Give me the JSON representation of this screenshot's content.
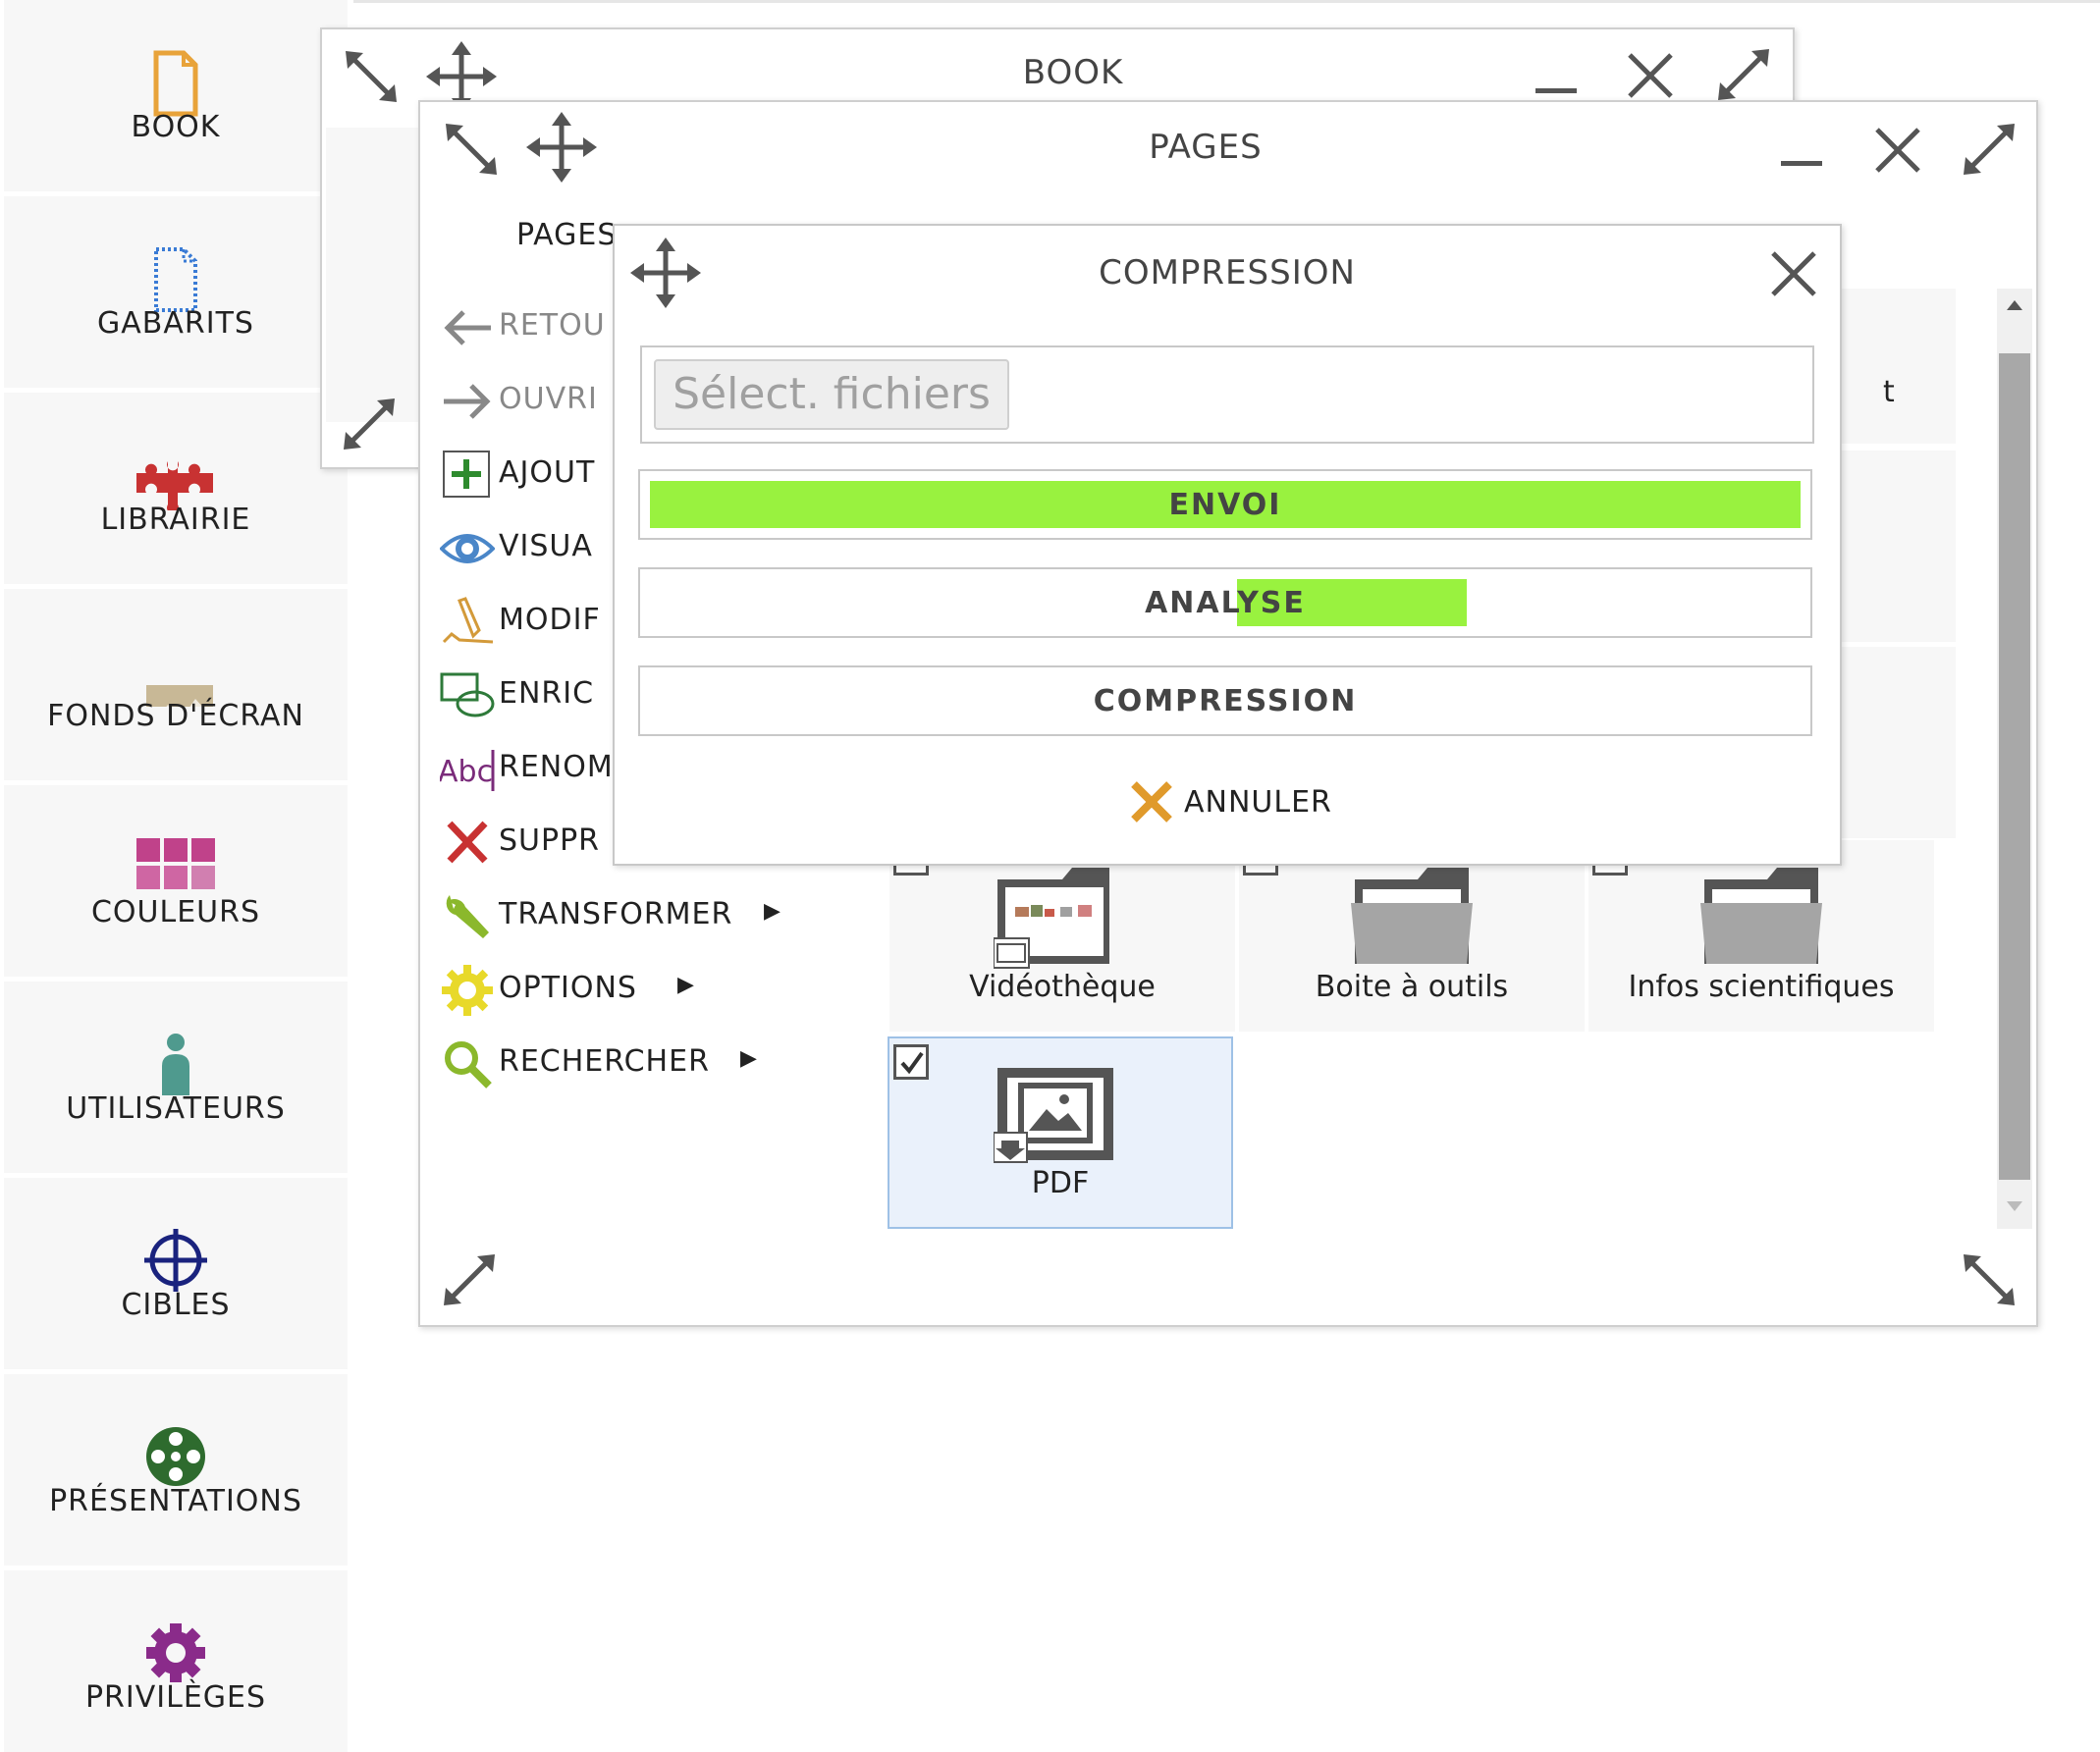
{
  "sidebar": {
    "items": [
      {
        "label": "BOOK",
        "icon": "book-icon",
        "color": "#e8a33a"
      },
      {
        "label": "GABARITS",
        "icon": "template-icon",
        "color": "#3a7bd5"
      },
      {
        "label": "LIBRAIRIE",
        "icon": "puzzle-icon",
        "color": "#c83232"
      },
      {
        "label": "FONDS D'ÉCRAN",
        "icon": "landscape-icon",
        "color": "#c8b896"
      },
      {
        "label": "COULEURS",
        "icon": "color-grid-icon",
        "color": "#c0428a"
      },
      {
        "label": "UTILISATEURS",
        "icon": "user-icon",
        "color": "#4f9a8e"
      },
      {
        "label": "CIBLES",
        "icon": "crosshair-icon",
        "color": "#1a237e"
      },
      {
        "label": "PRÉSENTATIONS",
        "icon": "film-reel-icon",
        "color": "#2e6b2e"
      },
      {
        "label": "PRIVILÈGES",
        "icon": "gear-icon",
        "color": "#8a2b8a"
      }
    ]
  },
  "book_window": {
    "title": "BOOK"
  },
  "pages_window": {
    "title": "PAGES",
    "menu_heading": "PAGES",
    "menu": [
      {
        "label": "RETOU",
        "icon": "arrow-left-icon"
      },
      {
        "label": "OUVRI",
        "icon": "arrow-right-icon"
      },
      {
        "label": "AJOUT",
        "icon": "add-icon"
      },
      {
        "label": "VISUA",
        "icon": "eye-icon"
      },
      {
        "label": "MODIF",
        "icon": "pen-icon"
      },
      {
        "label": "ENRIC",
        "icon": "shapes-icon"
      },
      {
        "label": "RENOM",
        "icon": "rename-icon"
      },
      {
        "label": "SUPPR",
        "icon": "delete-icon"
      },
      {
        "label": "TRANSFORMER",
        "icon": "wrench-icon"
      },
      {
        "label": "OPTIONS",
        "icon": "sun-gear-icon"
      },
      {
        "label": "RECHERCHER",
        "icon": "magnifier-icon"
      }
    ],
    "submenu_arrow": "▶",
    "partial_tile_text": "t",
    "tiles": [
      {
        "label": "Vidéothèque",
        "checked": false
      },
      {
        "label": "Boite à outils",
        "checked": false
      },
      {
        "label": "Infos scientifiques",
        "checked": false
      },
      {
        "label": "PDF",
        "checked": true
      }
    ]
  },
  "compression_dialog": {
    "title": "COMPRESSION",
    "file_button": "Sélect. fichiers",
    "bars": [
      {
        "label": "ENVOI",
        "progress": 1.0,
        "color": "#99f23f"
      },
      {
        "label": "ANALYSE",
        "progress": 0.2,
        "color": "#99f23f"
      },
      {
        "label": "COMPRESSION",
        "progress": 0,
        "color": "#99f23f"
      }
    ],
    "cancel_label": "ANNULER",
    "cancel_color": "#e09a2b"
  }
}
